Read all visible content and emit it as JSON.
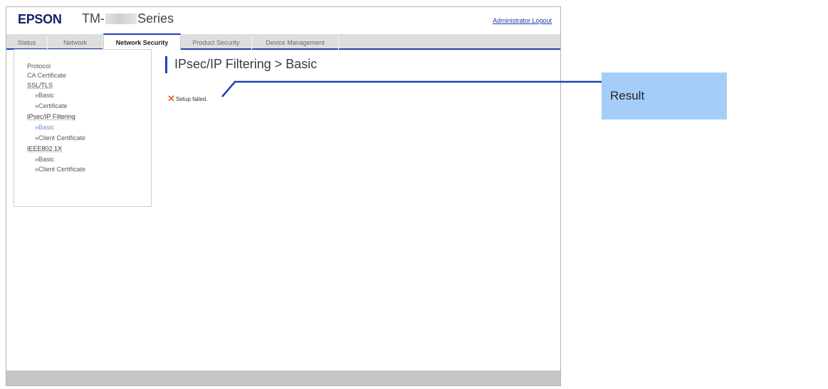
{
  "header": {
    "logo": "EPSON",
    "model_prefix": "TM-",
    "model_suffix": "Series",
    "logout_label": "Administrator Logout"
  },
  "tabs": [
    {
      "label": "Status"
    },
    {
      "label": "Network"
    },
    {
      "label": "Network Security",
      "active": true
    },
    {
      "label": "Product Security"
    },
    {
      "label": "Device Management"
    }
  ],
  "sidebar": {
    "items": [
      {
        "label": "Protocol"
      },
      {
        "label": "CA Certificate"
      },
      {
        "label": "SSL/TLS"
      },
      {
        "label": "»Basic"
      },
      {
        "label": "»Certificate"
      },
      {
        "label": "IPsec/IP Filtering"
      },
      {
        "label": "»Basic",
        "active": true
      },
      {
        "label": "»Client Certificate"
      },
      {
        "label": "IEEE802.1X"
      },
      {
        "label": "»Basic"
      },
      {
        "label": "»Client Certificate"
      }
    ]
  },
  "main": {
    "title": "IPsec/IP Filtering > Basic",
    "status_icon": "✕",
    "status_text": "Setup failed."
  },
  "callout": {
    "label": "Result"
  },
  "colors": {
    "accent": "#1f3fb6",
    "error": "#e2692b",
    "callout_bg": "#a5cdfa",
    "logo": "#12226b"
  },
  "icons": {
    "status": "error-x-icon"
  }
}
